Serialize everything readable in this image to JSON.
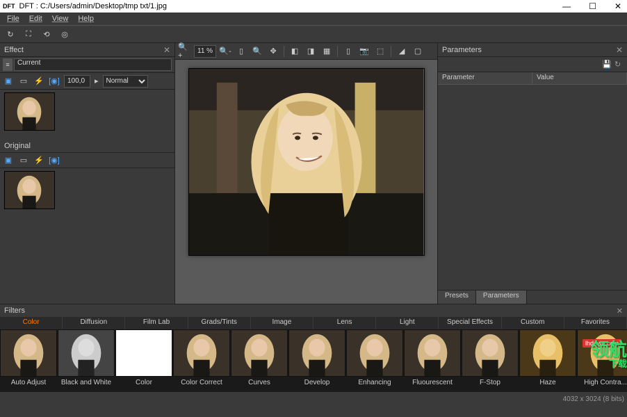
{
  "window": {
    "app_icon_text": "DFT",
    "title": "DFT : C:/Users/admin/Desktop/tmp txt/1.jpg"
  },
  "menubar": [
    "File",
    "Edit",
    "View",
    "Help"
  ],
  "effect_panel": {
    "title": "Effect",
    "current_label": "Current",
    "value": "100,0",
    "blend_mode": "Normal",
    "original_label": "Original"
  },
  "center": {
    "zoom": "11 %"
  },
  "parameters_panel": {
    "title": "Parameters",
    "col1": "Parameter",
    "col2": "Value",
    "tabs": [
      "Presets",
      "Parameters"
    ],
    "active_tab_index": 1
  },
  "filters": {
    "title": "Filters",
    "categories": [
      "Color",
      "Diffusion",
      "Film Lab",
      "Grads/Tints",
      "Image",
      "Lens",
      "Light",
      "Special Effects",
      "Custom",
      "Favorites"
    ],
    "active_category_index": 0,
    "items": [
      "Auto Adjust",
      "Black and White",
      "Color",
      "Color Correct",
      "Curves",
      "Develop",
      "Enhancing",
      "Fluourescent",
      "F-Stop",
      "Haze",
      "High Contra..."
    ]
  },
  "status": {
    "dimensions": "4032 x 3024 (8 bits)"
  },
  "watermark": {
    "big": "领航",
    "small": "下载",
    "site": "lhdown.com"
  }
}
